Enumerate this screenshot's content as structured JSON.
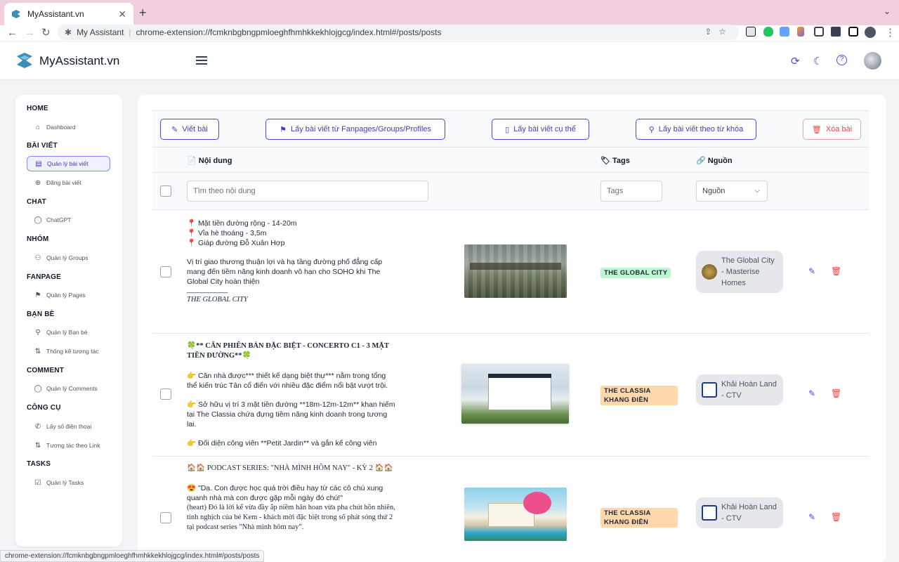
{
  "browser": {
    "tab_title": "MyAssistant.vn",
    "new_tab": "+",
    "site_name": "My Assistant",
    "url": "chrome-extension://fcmknbgbngpmloeghfhmhkkekhlojgcg/index.html#/posts/posts",
    "status_url": "chrome-extension://fcmknbgbngpmloeghfhmhkkekhlojgcg/index.html#/posts/posts"
  },
  "app": {
    "brand": "MyAssistant.vn",
    "accent_color": "#4f46e5"
  },
  "sidebar": {
    "sections": [
      {
        "title": "HOME",
        "items": [
          {
            "label": "Dashboard",
            "icon": "home-icon"
          }
        ]
      },
      {
        "title": "BÀI VIẾT",
        "items": [
          {
            "label": "Quản lý bài viết",
            "icon": "document-icon"
          },
          {
            "label": "Đăng bài viết",
            "icon": "upload-icon"
          }
        ]
      },
      {
        "title": "CHAT",
        "items": [
          {
            "label": "ChatGPT",
            "icon": "chat-icon"
          }
        ]
      },
      {
        "title": "NHÓM",
        "items": [
          {
            "label": "Quản lý Groups",
            "icon": "users-icon"
          }
        ]
      },
      {
        "title": "FANPAGE",
        "items": [
          {
            "label": "Quản lý Pages",
            "icon": "flag-icon"
          }
        ]
      },
      {
        "title": "BẠN BÈ",
        "items": [
          {
            "label": "Quản lý Bạn bè",
            "icon": "user-icon"
          },
          {
            "label": "Thống kê tương tác",
            "icon": "sort-icon"
          }
        ]
      },
      {
        "title": "COMMENT",
        "items": [
          {
            "label": "Quản lý Comments",
            "icon": "comment-icon"
          }
        ]
      },
      {
        "title": "CÔNG CỤ",
        "items": [
          {
            "label": "Lấy số điện thoại",
            "icon": "phone-icon"
          },
          {
            "label": "Tương tác theo Link",
            "icon": "sort-icon"
          }
        ]
      },
      {
        "title": "TASKS",
        "items": [
          {
            "label": "Quản lý Tasks",
            "icon": "checkbox-icon"
          }
        ]
      }
    ],
    "active_item": "Quản lý bài viết"
  },
  "toolbar": {
    "write": "Viết bài",
    "fetch_sources": "Lấy bài viết từ Fanpages/Groups/Profiles",
    "fetch_specific": "Lấy bài viết cụ thể",
    "fetch_keyword": "Lấy bài viết theo từ khóa",
    "delete": "Xóa bài"
  },
  "table": {
    "col_content": "Nội dung",
    "col_tags": "Tags",
    "col_source": "Nguồn",
    "search_placeholder": "Tìm theo nội dung",
    "tags_placeholder": "Tags",
    "source_select": "Nguồn"
  },
  "rows": [
    {
      "lines": [
        "📍 Mặt tiền đường rộng - 14-20m",
        "📍 Vỉa hè thoáng - 3,5m",
        "📍 Giáp đường Đỗ Xuân Hợp",
        "Vị trí giao thương thuận lợi và hạ tầng đường phố đẳng cấp mang đến tiềm năng kinh doanh vô hạn cho SOHO khi The Global City hoàn thiện",
        "__________",
        "THE GLOBAL CITY"
      ],
      "tag": "THE GLOBAL CITY",
      "tag_color": "#bbf7d0",
      "source": "The Global City - Masterise Homes"
    },
    {
      "lines": [
        "🍀** CĂN PHIÊN BẢN ĐẶC BIỆT - CONCERTO C1 - 3 MẶT TIỀN ĐƯỜNG**🍀",
        "👉 Căn nhà được*** thiết kế dạng biệt thự*** nằm trong tổng thể kiến trúc Tân cổ điển với nhiều đặc điểm nổi bật vượt trội.",
        "👉 Sở hữu vị trí 3 mặt tiền đường **18m-12m-12m** khan hiếm tại The Classia chứa đựng tiềm năng kinh doanh trong tương lai.",
        "👉  Đối diện công viên **Petit Jardin** và gắn kế công viên"
      ],
      "tag": "THE CLASSIA KHANG ĐIỀN",
      "tag_color": "#fed7aa",
      "source": "Khải Hoàn Land - CTV"
    },
    {
      "lines": [
        "🏠🏠 PODCAST SERIES: \"NHÀ MÌNH HÔM NAY\" - KỲ 2 🏠🏠",
        "😍 \"Dạ. Con được học quá trời điều hay từ các cô chú xung quanh nhà mà con được gặp mỗi ngày đó chú!\"",
        "(heart) Đó là lời kể vừa đầy ắp niềm hân hoan vừa pha chút hồn nhiên, tinh nghịch của bé Kem - khách mời đặc biệt trong số phát sóng thứ 2 tại podcast series \"Nhà mình hôm nay\"."
      ],
      "tag": "THE CLASSIA KHANG ĐIỀN",
      "tag_color": "#fed7aa",
      "source": "Khải Hoàn Land - CTV"
    }
  ]
}
